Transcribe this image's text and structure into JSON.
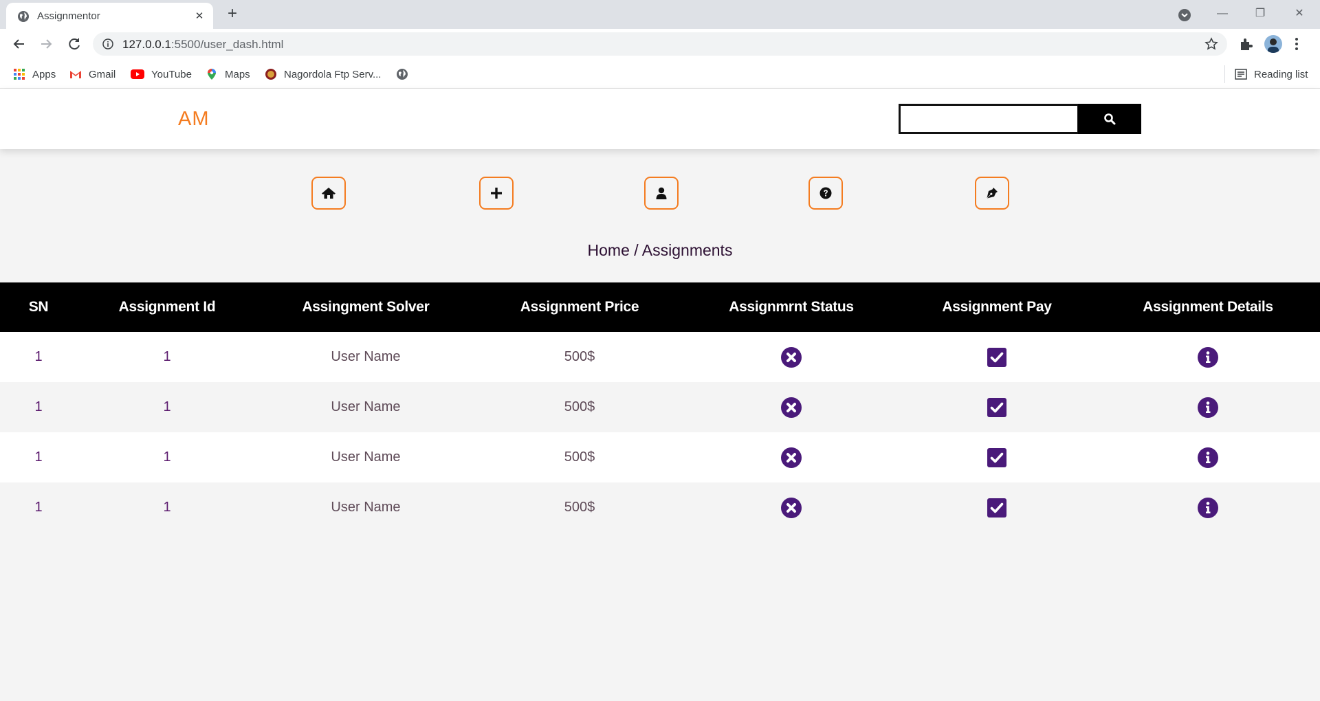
{
  "browser": {
    "tab_title": "Assignmentor",
    "url_host": "127.0.0.1",
    "url_path": ":5500/user_dash.html",
    "bookmarks": [
      {
        "label": "Apps",
        "icon": "apps-grid-icon"
      },
      {
        "label": "Gmail",
        "icon": "gmail-icon"
      },
      {
        "label": "YouTube",
        "icon": "youtube-icon"
      },
      {
        "label": "Maps",
        "icon": "maps-icon"
      },
      {
        "label": "Nagordola Ftp Serv...",
        "icon": "ftp-server-icon"
      }
    ],
    "reading_list": "Reading list"
  },
  "header": {
    "logo": "AM",
    "search": {
      "placeholder": "",
      "value": ""
    }
  },
  "nav_icons": [
    "home-icon",
    "plus-icon",
    "user-icon",
    "question-icon",
    "pen-icon"
  ],
  "breadcrumb": "Home / Assignments",
  "table": {
    "columns": [
      "SN",
      "Assignment Id",
      "Assingment Solver",
      "Assignment Price",
      "Assignmrnt Status",
      "Assignment Pay",
      "Assignment Details"
    ],
    "rows": [
      {
        "sn": "1",
        "id": "1",
        "solver": "User Name",
        "price": "500$",
        "status": "times-circle-icon",
        "pay": "check-square-icon",
        "details": "info-circle-icon"
      },
      {
        "sn": "1",
        "id": "1",
        "solver": "User Name",
        "price": "500$",
        "status": "times-circle-icon",
        "pay": "check-square-icon",
        "details": "info-circle-icon"
      },
      {
        "sn": "1",
        "id": "1",
        "solver": "User Name",
        "price": "500$",
        "status": "times-circle-icon",
        "pay": "check-square-icon",
        "details": "info-circle-icon"
      },
      {
        "sn": "1",
        "id": "1",
        "solver": "User Name",
        "price": "500$",
        "status": "times-circle-icon",
        "pay": "check-square-icon",
        "details": "info-circle-icon"
      }
    ]
  },
  "colors": {
    "accent": "#f47c20",
    "icon_purple": "#4a1a7a",
    "header_bg": "#000000"
  }
}
